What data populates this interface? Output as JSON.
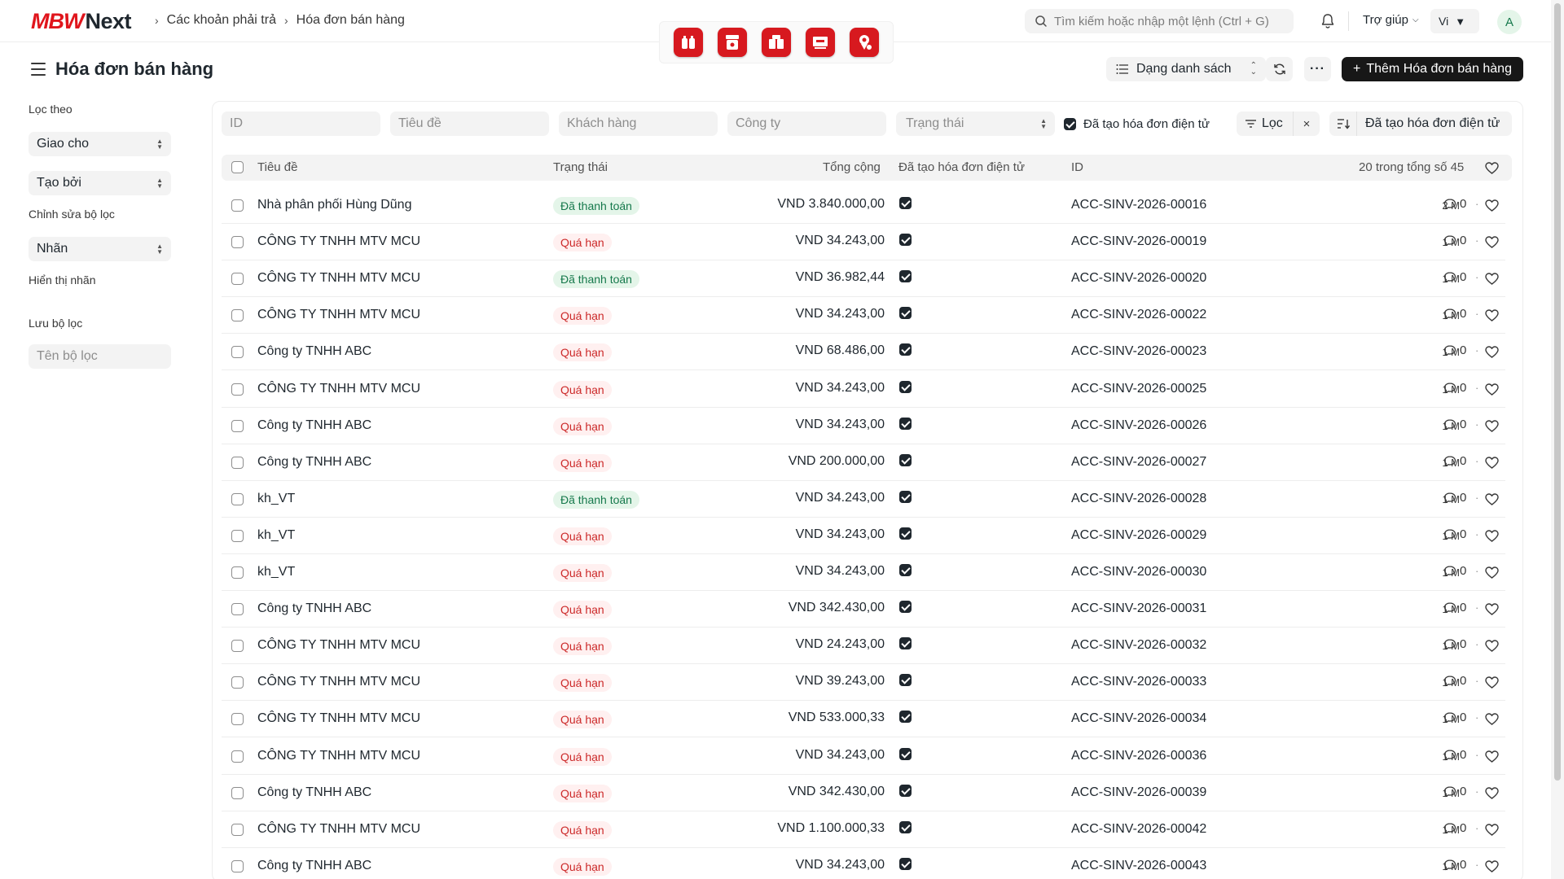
{
  "brand": {
    "logo_mbw": "MBW",
    "logo_next": "Next",
    "brand_color": "#e0151c"
  },
  "breadcrumb": {
    "items": [
      "Các khoản phải trả",
      "Hóa đơn bán hàng"
    ],
    "separator": "›"
  },
  "app_tray": {
    "accent_color": "#d7191f",
    "icons": [
      "bottles-app-icon",
      "printer-app-icon",
      "boxes-app-icon",
      "screen-app-icon",
      "location-app-icon"
    ]
  },
  "search": {
    "placeholder": "Tìm kiếm hoặc nhập một lệnh (Ctrl + G)"
  },
  "navbar": {
    "help_label": "Trợ giúp",
    "lang_label": "Vi",
    "avatar_letter": "A"
  },
  "page": {
    "title": "Hóa đơn bán hàng",
    "view_label": "Dạng danh sách",
    "more_label": "···",
    "add_label": "Thêm Hóa đơn bán hàng"
  },
  "sidebar": {
    "filter_by_label": "Lọc theo",
    "assigned_to": "Giao cho",
    "created_by": "Tạo bởi",
    "edit_filters": "Chỉnh sửa bộ lọc",
    "tags": "Nhãn",
    "show_tags": "Hiển thị nhãn",
    "save_filter_label": "Lưu bộ lọc",
    "filter_name_placeholder": "Tên bộ lọc"
  },
  "filters": {
    "id_placeholder": "ID",
    "title_placeholder": "Tiêu đề",
    "customer_placeholder": "Khách hàng",
    "company_placeholder": "Công ty",
    "status_placeholder": "Trạng thái",
    "einvoice_label": "Đã tạo hóa đơn điện tử",
    "einvoice_checked": true,
    "filter_label": "Lọc",
    "clear_label": "×",
    "sort_label": "Đã tạo hóa đơn điện tử"
  },
  "table": {
    "columns": {
      "title": "Tiêu đề",
      "status": "Trạng thái",
      "total": "Tổng cộng",
      "einvoice": "Đã tạo hóa đơn điện tử",
      "id": "ID"
    },
    "count_label": "20 trong tổng số 45",
    "rows": [
      {
        "title": "Nhà phân phối Hùng Dũng",
        "status": "Đã thanh toán",
        "status_type": "paid",
        "total": "VND 3.840.000,00",
        "einvoice": true,
        "id": "ACC-SINV-2026-00016",
        "age": "2 M",
        "comments": "0"
      },
      {
        "title": "CÔNG TY TNHH MTV MCU",
        "status": "Quá hạn",
        "status_type": "over",
        "total": "VND 34.243,00",
        "einvoice": true,
        "id": "ACC-SINV-2026-00019",
        "age": "1 M",
        "comments": "0"
      },
      {
        "title": "CÔNG TY TNHH MTV MCU",
        "status": "Đã thanh toán",
        "status_type": "paid",
        "total": "VND 36.982,44",
        "einvoice": true,
        "id": "ACC-SINV-2026-00020",
        "age": "1 M",
        "comments": "0"
      },
      {
        "title": "CÔNG TY TNHH MTV MCU",
        "status": "Quá hạn",
        "status_type": "over",
        "total": "VND 34.243,00",
        "einvoice": true,
        "id": "ACC-SINV-2026-00022",
        "age": "1 M",
        "comments": "0"
      },
      {
        "title": "Công ty TNHH ABC",
        "status": "Quá hạn",
        "status_type": "over",
        "total": "VND 68.486,00",
        "einvoice": true,
        "id": "ACC-SINV-2026-00023",
        "age": "1 M",
        "comments": "0"
      },
      {
        "title": "CÔNG TY TNHH MTV MCU",
        "status": "Quá hạn",
        "status_type": "over",
        "total": "VND 34.243,00",
        "einvoice": true,
        "id": "ACC-SINV-2026-00025",
        "age": "1 M",
        "comments": "0"
      },
      {
        "title": "Công ty TNHH ABC",
        "status": "Quá hạn",
        "status_type": "over",
        "total": "VND 34.243,00",
        "einvoice": true,
        "id": "ACC-SINV-2026-00026",
        "age": "1 M",
        "comments": "0"
      },
      {
        "title": "Công ty TNHH ABC",
        "status": "Quá hạn",
        "status_type": "over",
        "total": "VND 200.000,00",
        "einvoice": true,
        "id": "ACC-SINV-2026-00027",
        "age": "1 M",
        "comments": "0"
      },
      {
        "title": "kh_VT",
        "status": "Đã thanh toán",
        "status_type": "paid",
        "total": "VND 34.243,00",
        "einvoice": true,
        "id": "ACC-SINV-2026-00028",
        "age": "1 M",
        "comments": "0"
      },
      {
        "title": "kh_VT",
        "status": "Quá hạn",
        "status_type": "over",
        "total": "VND 34.243,00",
        "einvoice": true,
        "id": "ACC-SINV-2026-00029",
        "age": "1 M",
        "comments": "0"
      },
      {
        "title": "kh_VT",
        "status": "Quá hạn",
        "status_type": "over",
        "total": "VND 34.243,00",
        "einvoice": true,
        "id": "ACC-SINV-2026-00030",
        "age": "1 M",
        "comments": "0"
      },
      {
        "title": "Công ty TNHH ABC",
        "status": "Quá hạn",
        "status_type": "over",
        "total": "VND 342.430,00",
        "einvoice": true,
        "id": "ACC-SINV-2026-00031",
        "age": "1 M",
        "comments": "0"
      },
      {
        "title": "CÔNG TY TNHH MTV MCU",
        "status": "Quá hạn",
        "status_type": "over",
        "total": "VND 24.243,00",
        "einvoice": true,
        "id": "ACC-SINV-2026-00032",
        "age": "1 M",
        "comments": "0"
      },
      {
        "title": "CÔNG TY TNHH MTV MCU",
        "status": "Quá hạn",
        "status_type": "over",
        "total": "VND 39.243,00",
        "einvoice": true,
        "id": "ACC-SINV-2026-00033",
        "age": "1 M",
        "comments": "0"
      },
      {
        "title": "CÔNG TY TNHH MTV MCU",
        "status": "Quá hạn",
        "status_type": "over",
        "total": "VND 533.000,33",
        "einvoice": true,
        "id": "ACC-SINV-2026-00034",
        "age": "1 M",
        "comments": "0"
      },
      {
        "title": "CÔNG TY TNHH MTV MCU",
        "status": "Quá hạn",
        "status_type": "over",
        "total": "VND 34.243,00",
        "einvoice": true,
        "id": "ACC-SINV-2026-00036",
        "age": "1 M",
        "comments": "0"
      },
      {
        "title": "Công ty TNHH ABC",
        "status": "Quá hạn",
        "status_type": "over",
        "total": "VND 342.430,00",
        "einvoice": true,
        "id": "ACC-SINV-2026-00039",
        "age": "1 M",
        "comments": "0"
      },
      {
        "title": "CÔNG TY TNHH MTV MCU",
        "status": "Quá hạn",
        "status_type": "over",
        "total": "VND 1.100.000,33",
        "einvoice": true,
        "id": "ACC-SINV-2026-00042",
        "age": "1 M",
        "comments": "0"
      },
      {
        "title": "Công ty TNHH ABC",
        "status": "Quá hạn",
        "status_type": "over",
        "total": "VND 34.243,00",
        "einvoice": true,
        "id": "ACC-SINV-2026-00043",
        "age": "1 M",
        "comments": "0"
      }
    ]
  }
}
